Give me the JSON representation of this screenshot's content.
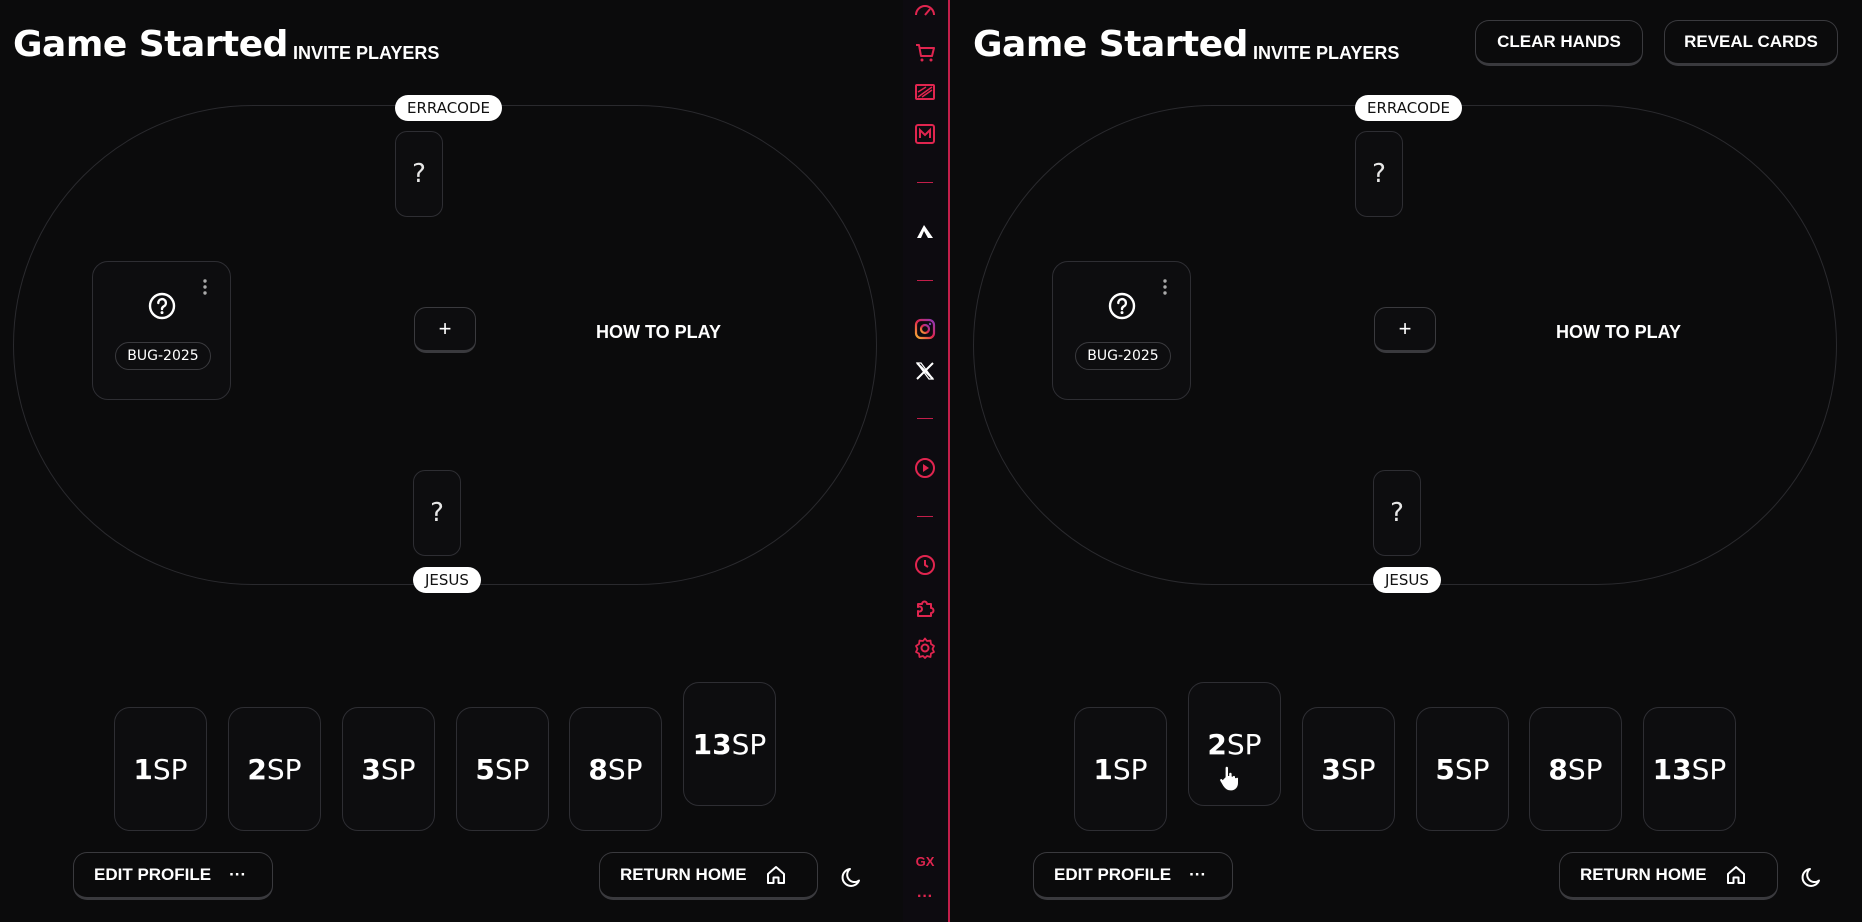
{
  "left": {
    "title": "Game Started",
    "invite": "INVITE PLAYERS",
    "players": {
      "top": "ERRACODE",
      "bottom": "JESUS"
    },
    "card_back": "?",
    "story": {
      "tag": "BUG-2025"
    },
    "plus": "+",
    "how_to_play": "HOW TO PLAY",
    "votes": [
      {
        "num": "1",
        "unit": "SP"
      },
      {
        "num": "2",
        "unit": "SP"
      },
      {
        "num": "3",
        "unit": "SP"
      },
      {
        "num": "5",
        "unit": "SP"
      },
      {
        "num": "8",
        "unit": "SP"
      },
      {
        "num": "13",
        "unit": "SP"
      }
    ],
    "selected_vote": "13",
    "edit_profile": "EDIT PROFILE",
    "more": "···",
    "return_home": "RETURN HOME"
  },
  "right": {
    "title": "Game Started",
    "invite": "INVITE PLAYERS",
    "clear_hands": "CLEAR HANDS",
    "reveal_cards": "REVEAL CARDS",
    "players": {
      "top": "ERRACODE",
      "bottom": "JESUS"
    },
    "card_back": "?",
    "story": {
      "tag": "BUG-2025"
    },
    "plus": "+",
    "how_to_play": "HOW TO PLAY",
    "votes": [
      {
        "num": "1",
        "unit": "SP"
      },
      {
        "num": "2",
        "unit": "SP"
      },
      {
        "num": "3",
        "unit": "SP"
      },
      {
        "num": "5",
        "unit": "SP"
      },
      {
        "num": "8",
        "unit": "SP"
      },
      {
        "num": "13",
        "unit": "SP"
      }
    ],
    "selected_vote": "2",
    "edit_profile": "EDIT PROFILE",
    "more": "···",
    "return_home": "RETURN HOME"
  },
  "sidebar": {
    "accent": "#e0254f",
    "gx_label": "GX",
    "more": "···",
    "icons": [
      "speed-dial-icon",
      "shopping-icon",
      "wallpaper-icon",
      "mail-icon",
      "app-logo-icon",
      "instagram-icon",
      "x-twitter-icon",
      "player-icon",
      "history-icon",
      "extensions-icon",
      "settings-icon"
    ]
  }
}
